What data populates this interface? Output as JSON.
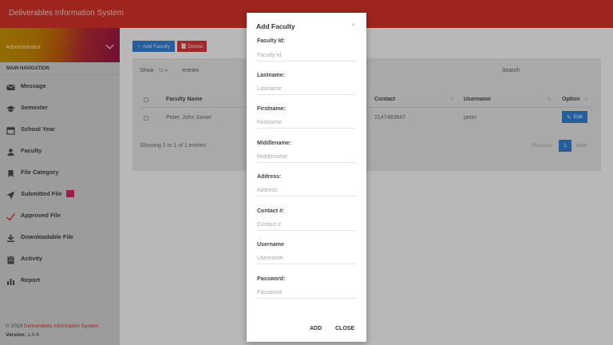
{
  "header": {
    "brand": "Deliverables Information System"
  },
  "sidebar": {
    "user_name": "Administrator",
    "nav_heading": "MAIN NAVIGATION",
    "items": [
      {
        "label": "Message",
        "icon": "envelope-icon"
      },
      {
        "label": "Semester",
        "icon": "graduation-cap-icon"
      },
      {
        "label": "School Year",
        "icon": "calendar-icon"
      },
      {
        "label": "Faculty",
        "icon": "user-icon"
      },
      {
        "label": "File Category",
        "icon": "bookmark-icon"
      },
      {
        "label": "Submitted File",
        "icon": "send-icon"
      },
      {
        "label": "Approved File",
        "icon": "check-icon"
      },
      {
        "label": "Downloadable File",
        "icon": "download-icon"
      },
      {
        "label": "Activity",
        "icon": "clipboard-icon"
      },
      {
        "label": "Report",
        "icon": "bar-chart-icon"
      }
    ],
    "footer_prefix": "© 2019",
    "footer_link": "Deliverables Information System",
    "version_label": "Version:",
    "version_value": "1.0.4"
  },
  "toolbar": {
    "add_label": "Add Faculty",
    "delete_label": "Delete"
  },
  "table": {
    "show_label": "Show",
    "show_value": "10",
    "entries_label": "entries",
    "search_label": "Search",
    "columns": [
      "Faculty Name",
      "Contact",
      "Username",
      "Option"
    ],
    "rows": [
      {
        "name": "Peter, John Xavier",
        "contact": "2147483647",
        "username": "peter",
        "action": "Edit"
      }
    ],
    "info": "Showing 1 to 1 of 1 entries",
    "prev_label": "Previous",
    "page": "1",
    "next_label": "Next"
  },
  "modal": {
    "title": "Add Faculty",
    "close_glyph": "×",
    "fields": [
      {
        "label": "Faculty Id:",
        "placeholder": "Faculty Id"
      },
      {
        "label": "Lastname:",
        "placeholder": "Lastname"
      },
      {
        "label": "Firstname:",
        "placeholder": "Firstname"
      },
      {
        "label": "Middlename:",
        "placeholder": "Middlename"
      },
      {
        "label": "Address:",
        "placeholder": "Address"
      },
      {
        "label": "Contact #:",
        "placeholder": "Contact #"
      },
      {
        "label": "Username",
        "placeholder": "Username"
      },
      {
        "label": "Password:",
        "placeholder": "Password"
      }
    ],
    "add_label": "ADD",
    "close_label": "CLOSE"
  },
  "colors": {
    "header": "#c62f26",
    "primary": "#2f76c2",
    "danger": "#c93434",
    "badge": "#c0265f"
  }
}
